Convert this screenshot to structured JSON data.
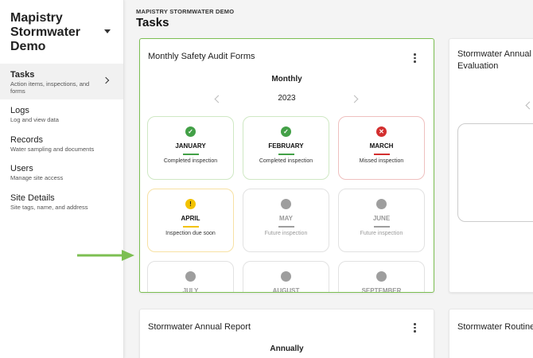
{
  "sidebar": {
    "brand": "Mapistry Stormwater Demo",
    "items": [
      {
        "title": "Tasks",
        "subtitle": "Action items, inspections, and forms"
      },
      {
        "title": "Logs",
        "subtitle": "Log and view data"
      },
      {
        "title": "Records",
        "subtitle": "Water sampling and documents"
      },
      {
        "title": "Users",
        "subtitle": "Manage site access"
      },
      {
        "title": "Site Details",
        "subtitle": "Site tags, name, and address"
      }
    ]
  },
  "header": {
    "breadcrumb": "MAPISTRY STORMWATER DEMO",
    "title": "Tasks"
  },
  "main_card": {
    "title": "Monthly Safety Audit Forms",
    "frequency": "Monthly",
    "year": "2023",
    "months": [
      {
        "name": "JANUARY",
        "status": "Completed inspection",
        "state": "completed"
      },
      {
        "name": "FEBRUARY",
        "status": "Completed inspection",
        "state": "completed"
      },
      {
        "name": "MARCH",
        "status": "Missed inspection",
        "state": "missed"
      },
      {
        "name": "APRIL",
        "status": "Inspection due soon",
        "state": "due"
      },
      {
        "name": "MAY",
        "status": "Future inspection",
        "state": "future"
      },
      {
        "name": "JUNE",
        "status": "Future inspection",
        "state": "future"
      },
      {
        "name": "JULY",
        "status": "",
        "state": "future"
      },
      {
        "name": "AUGUST",
        "status": "",
        "state": "future"
      },
      {
        "name": "SEPTEMBER",
        "status": "",
        "state": "future"
      }
    ],
    "icons": {
      "completed": "check-icon",
      "missed": "x-icon",
      "due": "exclamation-icon",
      "future": "circle-icon"
    }
  },
  "right_top_card": {
    "title": "Stormwater Annual Evaluation"
  },
  "bottom_card": {
    "title": "Stormwater Annual Report",
    "frequency": "Annually"
  },
  "right_bottom_card": {
    "title": "Stormwater Routine"
  },
  "colors": {
    "completed": "#43a047",
    "missed": "#d32f2f",
    "due": "#f2c200",
    "future": "#9e9e9e",
    "highlight": "#7cbf52"
  }
}
